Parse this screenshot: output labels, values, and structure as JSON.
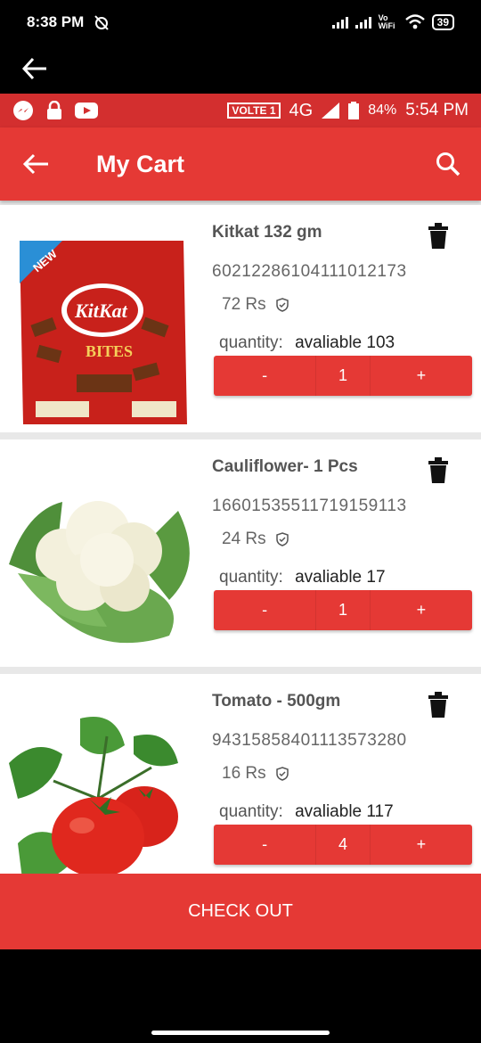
{
  "os_status": {
    "time": "8:38 PM",
    "network_label": "Vo WiFi",
    "battery": "39"
  },
  "inner_status": {
    "volte": "VOLTE 1",
    "network": "4G",
    "battery": "84%",
    "time": "5:54 PM"
  },
  "appbar": {
    "title": "My Cart"
  },
  "items": [
    {
      "name": "Kitkat 132 gm",
      "code": "60212286104111012173",
      "price": "72 Rs",
      "qty_label": "quantity:",
      "available": "avaliable 103",
      "minus": "-",
      "qty": "1",
      "plus": "+"
    },
    {
      "name": "Cauliflower- 1 Pcs",
      "code": "16601535511719159113",
      "price": "24 Rs",
      "qty_label": "quantity:",
      "available": "avaliable 17",
      "minus": "-",
      "qty": "1",
      "plus": "+"
    },
    {
      "name": "Tomato - 500gm",
      "code": "94315858401113573280",
      "price": "16 Rs",
      "qty_label": "quantity:",
      "available": "avaliable 117",
      "minus": "-",
      "qty": "4",
      "plus": "+"
    }
  ],
  "checkout_label": "CHECK OUT",
  "colors": {
    "primary": "#e53935",
    "status": "#d32f2f"
  }
}
